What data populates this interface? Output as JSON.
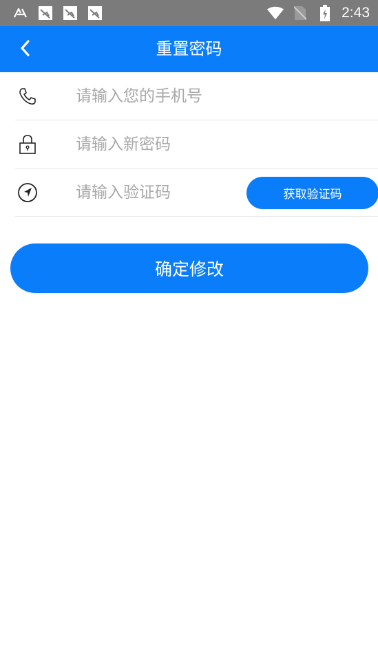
{
  "status_bar": {
    "time": "2:43",
    "left_icons": [
      "accessibility-icon",
      "notification-image-icon",
      "notification-image-icon",
      "notification-image-icon"
    ],
    "right_icons": [
      "wifi-icon",
      "no-sim-icon",
      "battery-charging-icon"
    ]
  },
  "app_bar": {
    "title": "重置密码",
    "back_icon": "chevron-left-icon"
  },
  "form": {
    "phone_placeholder": "请输入您的手机号",
    "password_placeholder": "请输入新密码",
    "code_placeholder": "请输入验证码",
    "get_code_label": "获取验证码"
  },
  "submit_label": "确定修改",
  "colors": {
    "primary": "#0a7dfa",
    "status_bar": "#7b7b7b",
    "divider": "#e6e6e6",
    "placeholder": "#a8a8a8"
  }
}
